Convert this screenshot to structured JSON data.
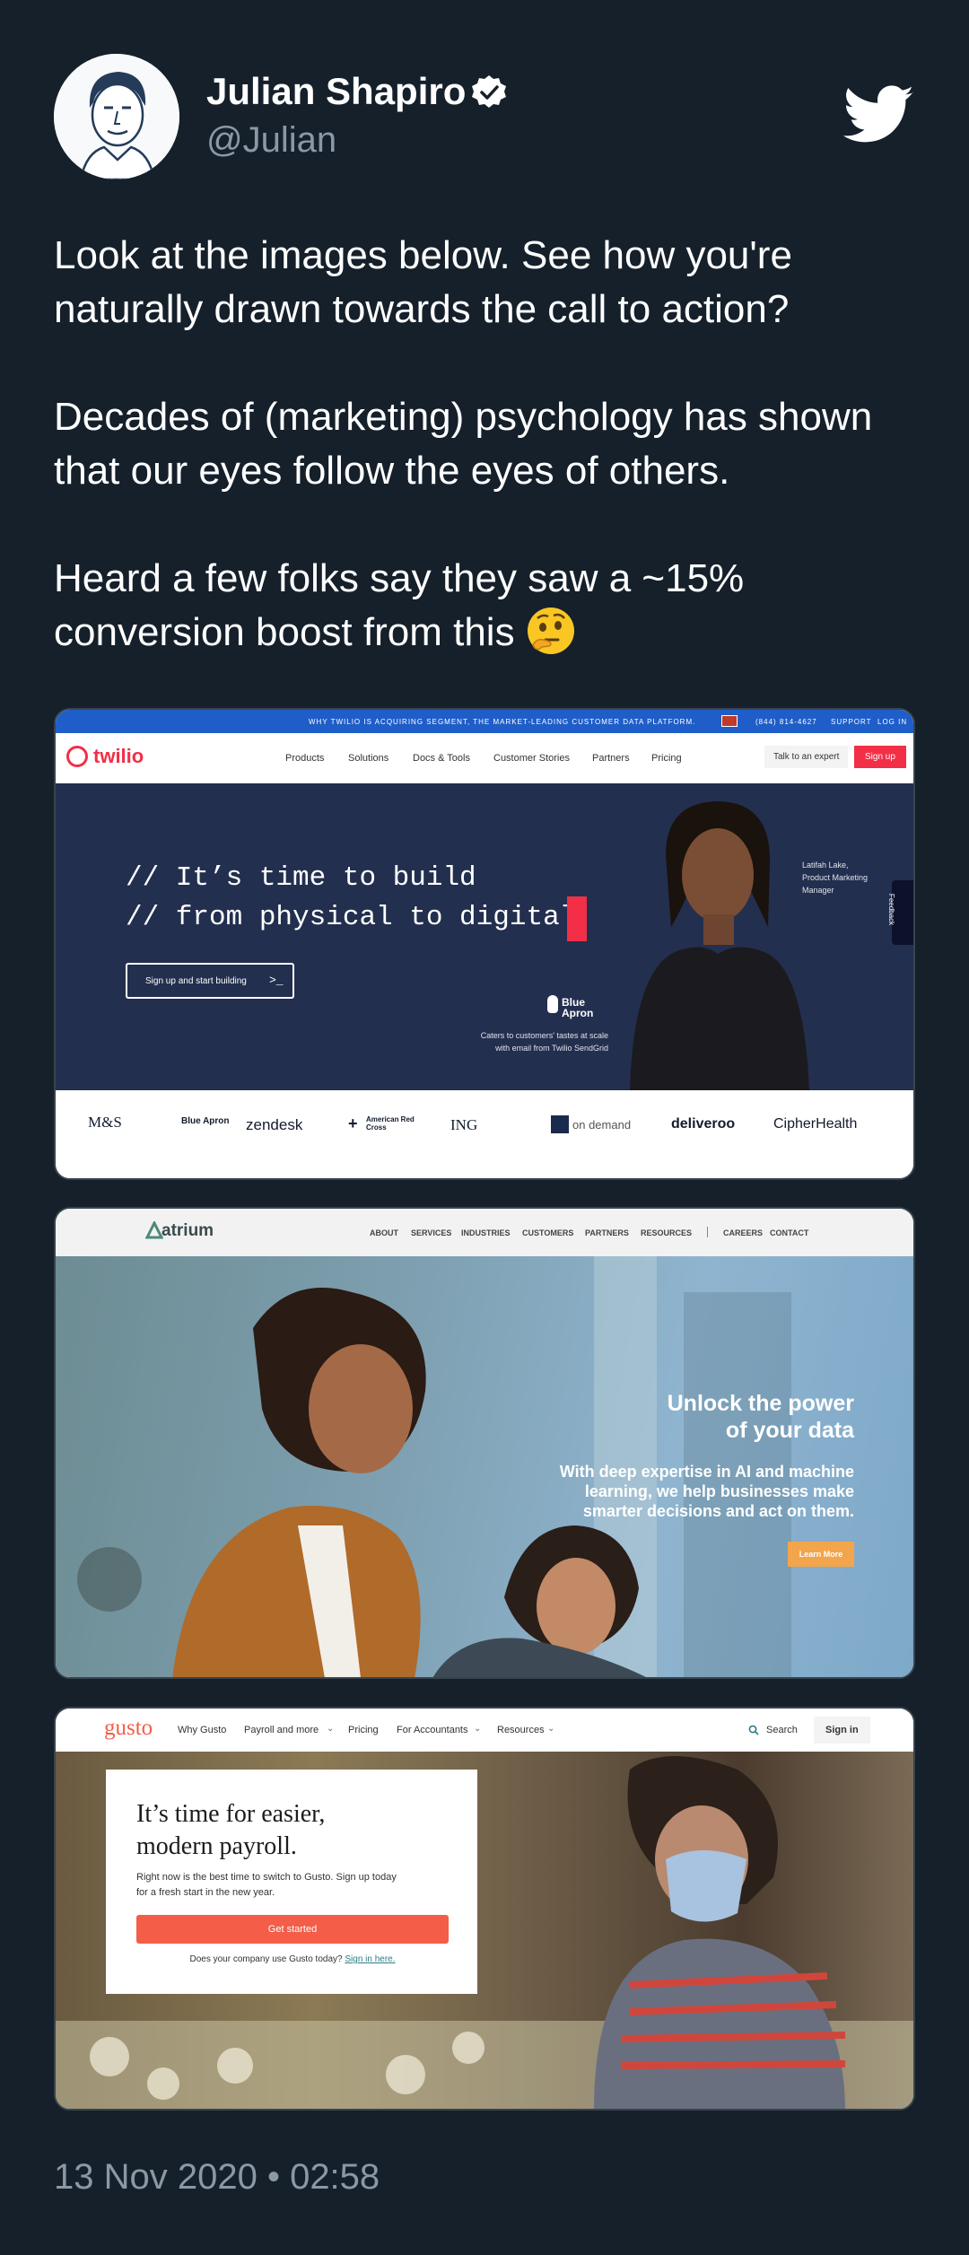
{
  "author": {
    "name": "Julian Shapiro",
    "handle": "@Julian"
  },
  "icons": {
    "verified": "verified-badge-icon",
    "bird": "twitter-bird-icon",
    "emoji": "thinking-face-emoji"
  },
  "colors": {
    "background": "#15202b",
    "text": "#ffffff",
    "muted": "#8b98a5",
    "twilio_red": "#f22f46",
    "atrium_orange": "#f2a54a",
    "gusto_coral": "#f45d48"
  },
  "tweet": {
    "paragraphs": [
      "Look at the images below. See how you're naturally drawn towards the call to action?",
      "Decades of (marketing) psychology has shown that our eyes follow the eyes of others.",
      "Heard a few folks say they saw a ~15% conversion boost from this"
    ],
    "timestamp": "13 Nov 2020 • 02:58"
  },
  "twilio": {
    "announcement": "WHY TWILIO IS ACQUIRING SEGMENT, THE MARKET-LEADING CUSTOMER DATA PLATFORM.",
    "phone": "(844) 814-4627",
    "support": "SUPPORT",
    "login": "LOG IN",
    "logo": "twilio",
    "nav": [
      "Products",
      "Solutions",
      "Docs & Tools",
      "Customer Stories",
      "Partners",
      "Pricing"
    ],
    "talk_button": "Talk to an expert",
    "signup_button": "Sign up",
    "headline_line1": "// It’s time to build",
    "headline_line2": "// from physical to digital",
    "cta": "Sign up and start building",
    "brand_caption": "Blue Apron",
    "caption_line1": "Caters to customers' tastes at scale",
    "caption_line2": "with email from Twilio SendGrid",
    "person_line1": "Latifah Lake,",
    "person_line2": "Product Marketing",
    "person_line3": "Manager",
    "feedback": "Feedback",
    "logos": [
      "M&S",
      "Blue Apron",
      "zendesk",
      "American Red Cross",
      "ING",
      "on demand",
      "deliveroo",
      "CipherHealth"
    ]
  },
  "atrium": {
    "logo": "atrium",
    "nav": [
      "ABOUT",
      "SERVICES",
      "INDUSTRIES",
      "CUSTOMERS",
      "PARTNERS",
      "RESOURCES"
    ],
    "nav_right": [
      "CAREERS",
      "CONTACT"
    ],
    "headline_line1": "Unlock the power",
    "headline_line2": "of your data",
    "sub_line1": "With deep expertise in AI and machine",
    "sub_line2": "learning, we help businesses make",
    "sub_line3": "smarter decisions and act on them.",
    "cta": "Learn More"
  },
  "gusto": {
    "logo": "gusto",
    "nav": [
      "Why Gusto",
      "Payroll and more",
      "Pricing",
      "For Accountants",
      "Resources"
    ],
    "search": "Search",
    "signin": "Sign in",
    "headline_line1": "It’s time for easier,",
    "headline_line2": "modern payroll.",
    "body_line1": "Right now is the best time to switch to Gusto. Sign up today",
    "body_line2": "for a fresh start in the new year.",
    "cta": "Get started",
    "footer_text": "Does your company use Gusto today?",
    "footer_link": "Sign in here."
  }
}
